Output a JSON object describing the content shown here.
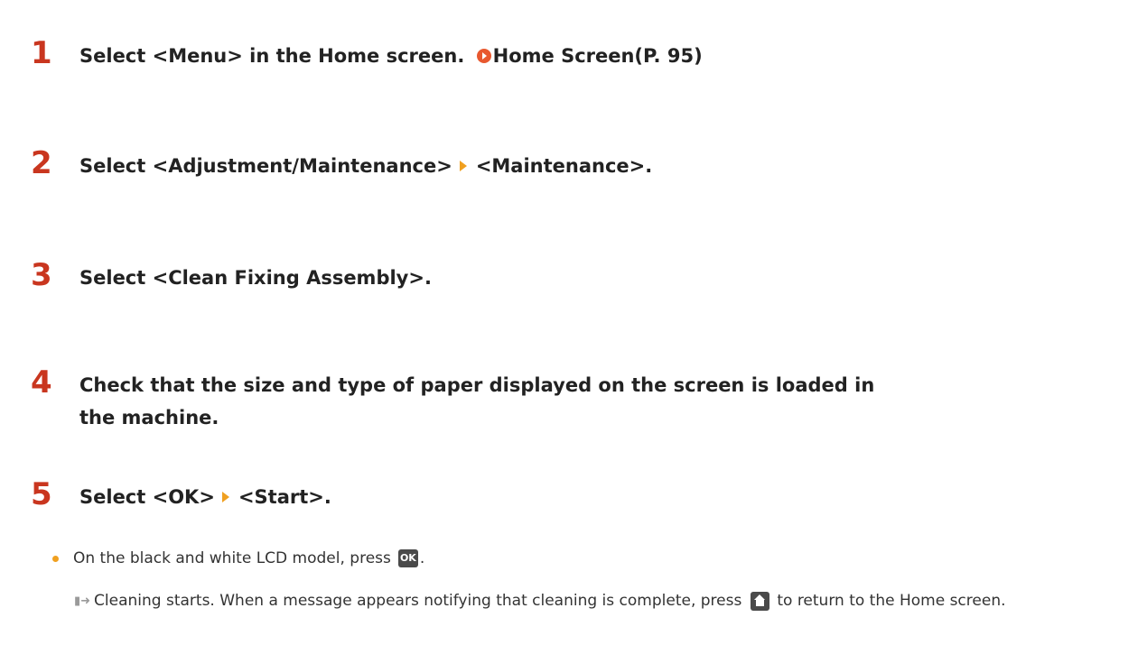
{
  "steps": [
    {
      "number": "1",
      "text": "Select <Menu> in the Home screen.",
      "link": "Home Screen(P. 95)"
    },
    {
      "number": "2",
      "text_before": "Select <Adjustment/Maintenance>",
      "text_after": "<Maintenance>."
    },
    {
      "number": "3",
      "text": "Select <Clean Fixing Assembly>."
    },
    {
      "number": "4",
      "text": "Check that the size and type of paper displayed on the screen is loaded in the machine."
    },
    {
      "number": "5",
      "text_before": "Select <OK>",
      "text_after": "<Start>."
    }
  ],
  "note": {
    "text_before": "On the black and white LCD model, press",
    "key_label": "OK",
    "text_after": "."
  },
  "result": {
    "text_before": "Cleaning starts. When a message appears notifying that cleaning is complete, press",
    "text_after": "to return to the Home screen."
  },
  "icons": {
    "link": "link-arrow-icon",
    "step_separator": "triangle-arrow-icon",
    "ok_key": "ok-key-icon",
    "home_key": "home-key-icon",
    "result_marker": "result-arrow-icon"
  },
  "colors": {
    "step_number": "#c9361f",
    "accent_arrow": "#f0a020",
    "link_icon": "#e8582f",
    "key_icon": "#4a4a4a"
  }
}
